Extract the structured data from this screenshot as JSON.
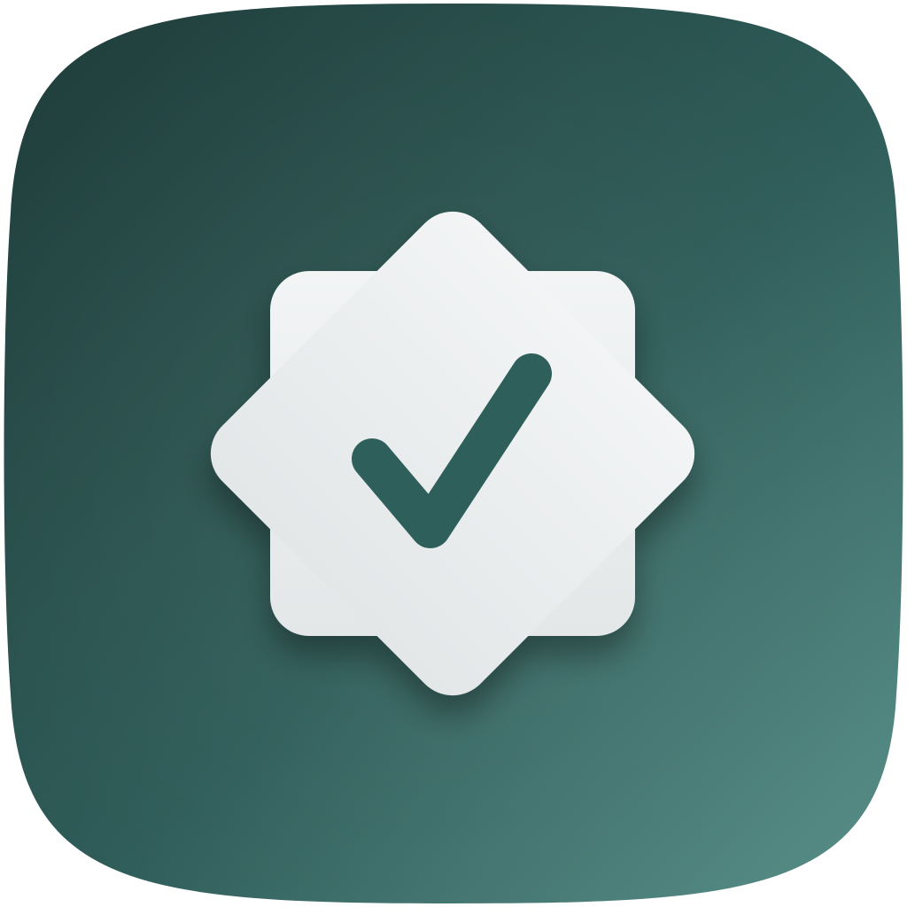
{
  "app_icon": {
    "icon": "verified-badge-icon",
    "inner_icon": "checkmark-icon",
    "colors": {
      "background_dark": "#1f3c3a",
      "background_mid": "#2f5d59",
      "background_light": "#5a918b",
      "badge_fill": "#f2f4f5",
      "badge_shade": "#e3e7e8",
      "checkmark": "#2f5f5b"
    }
  }
}
